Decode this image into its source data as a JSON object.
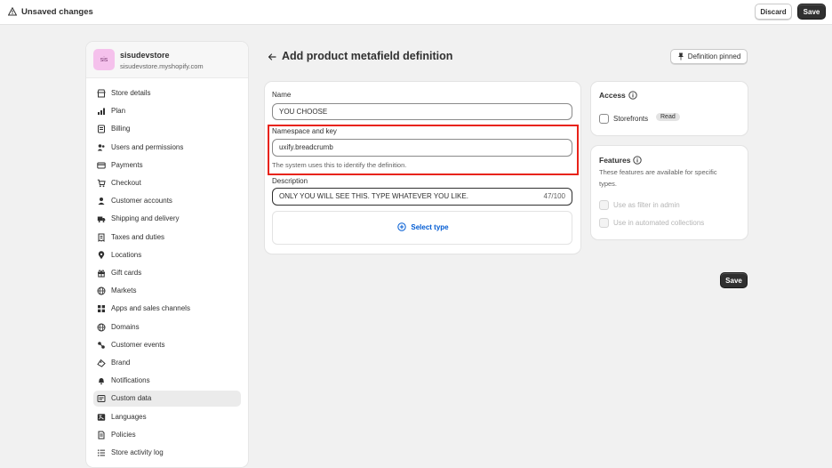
{
  "topbar": {
    "title": "Unsaved changes",
    "discard_label": "Discard",
    "save_label": "Save"
  },
  "store": {
    "avatar_text": "sis",
    "name": "sisudevstore",
    "url": "sisudevstore.myshopify.com"
  },
  "sidebar": {
    "items": [
      {
        "label": "Store details",
        "icon": "store-icon"
      },
      {
        "label": "Plan",
        "icon": "plan-chart-icon"
      },
      {
        "label": "Billing",
        "icon": "billing-icon"
      },
      {
        "label": "Users and permissions",
        "icon": "users-icon"
      },
      {
        "label": "Payments",
        "icon": "payments-icon"
      },
      {
        "label": "Checkout",
        "icon": "cart-icon"
      },
      {
        "label": "Customer accounts",
        "icon": "person-icon"
      },
      {
        "label": "Shipping and delivery",
        "icon": "truck-icon"
      },
      {
        "label": "Taxes and duties",
        "icon": "taxes-icon"
      },
      {
        "label": "Locations",
        "icon": "location-pin-icon"
      },
      {
        "label": "Gift cards",
        "icon": "gift-icon"
      },
      {
        "label": "Markets",
        "icon": "globe-icon"
      },
      {
        "label": "Apps and sales channels",
        "icon": "apps-icon"
      },
      {
        "label": "Domains",
        "icon": "globe-icon"
      },
      {
        "label": "Customer events",
        "icon": "events-icon"
      },
      {
        "label": "Brand",
        "icon": "brand-icon"
      },
      {
        "label": "Notifications",
        "icon": "bell-icon"
      },
      {
        "label": "Custom data",
        "icon": "custom-data-icon",
        "active": true
      },
      {
        "label": "Languages",
        "icon": "language-icon"
      },
      {
        "label": "Policies",
        "icon": "policies-icon"
      },
      {
        "label": "Store activity log",
        "icon": "list-icon"
      }
    ]
  },
  "page": {
    "title": "Add product metafield definition",
    "pinned_label": "Definition pinned"
  },
  "form": {
    "name_label": "Name",
    "name_value": "YOU CHOOSE",
    "namespace_label": "Namespace and key",
    "namespace_value": "uxify.breadcrumb",
    "namespace_help": "The system uses this to identify the definition.",
    "description_label": "Description",
    "description_value": "ONLY YOU WILL SEE THIS. TYPE WHATEVER YOU LIKE.",
    "description_count": "47/100",
    "select_type_label": "Select type"
  },
  "access": {
    "title": "Access",
    "storefronts_label": "Storefronts",
    "storefronts_badge": "Read"
  },
  "features": {
    "title": "Features",
    "description": "These features are available for specific types.",
    "filter_label": "Use as filter in admin",
    "collections_label": "Use in automated collections"
  },
  "footer": {
    "save_label": "Save"
  },
  "colors": {
    "accent_link": "#005bd3",
    "highlight": "#e8231a",
    "primary_button": "#303030"
  }
}
